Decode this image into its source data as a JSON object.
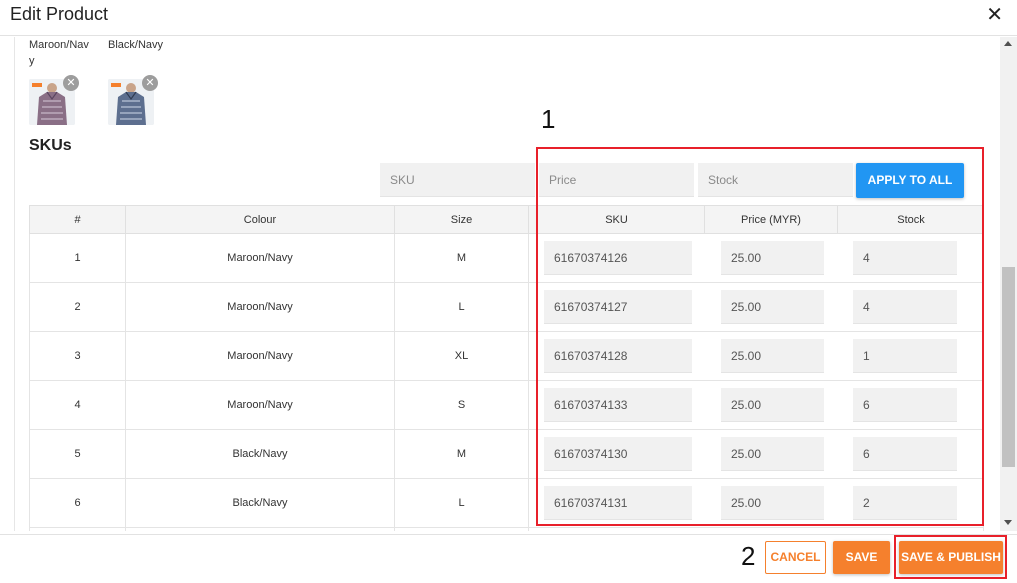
{
  "header": {
    "title": "Edit Product",
    "close_glyph": "✕"
  },
  "variants": [
    {
      "name": "Maroon/Navy",
      "image": "shirt-thumbnail-maroon",
      "remove_glyph": "✕"
    },
    {
      "name": "Black/Navy",
      "image": "shirt-thumbnail-black",
      "remove_glyph": "✕"
    }
  ],
  "skus": {
    "heading": "SKUs",
    "apply_all": {
      "sku_placeholder": "SKU",
      "price_placeholder": "Price",
      "stock_placeholder": "Stock",
      "button_label": "APPLY TO ALL",
      "button_color": "#2196f3"
    },
    "columns": [
      "#",
      "Colour",
      "Size",
      "SKU",
      "Price (MYR)",
      "Stock"
    ],
    "rows": [
      {
        "no": "1",
        "colour": "Maroon/Navy",
        "size": "M",
        "sku": "61670374126",
        "price": "25.00",
        "stock": "4"
      },
      {
        "no": "2",
        "colour": "Maroon/Navy",
        "size": "L",
        "sku": "61670374127",
        "price": "25.00",
        "stock": "4"
      },
      {
        "no": "3",
        "colour": "Maroon/Navy",
        "size": "XL",
        "sku": "61670374128",
        "price": "25.00",
        "stock": "1"
      },
      {
        "no": "4",
        "colour": "Maroon/Navy",
        "size": "S",
        "sku": "61670374133",
        "price": "25.00",
        "stock": "6"
      },
      {
        "no": "5",
        "colour": "Black/Navy",
        "size": "M",
        "sku": "61670374130",
        "price": "25.00",
        "stock": "6"
      },
      {
        "no": "6",
        "colour": "Black/Navy",
        "size": "L",
        "sku": "61670374131",
        "price": "25.00",
        "stock": "2"
      }
    ]
  },
  "annotations": {
    "marker_1": "1",
    "marker_2": "2",
    "highlight_color": "#e8202a"
  },
  "footer": {
    "cancel_label": "CANCEL",
    "save_label": "SAVE",
    "publish_label": "SAVE & PUBLISH",
    "accent_color": "#f5802d"
  }
}
